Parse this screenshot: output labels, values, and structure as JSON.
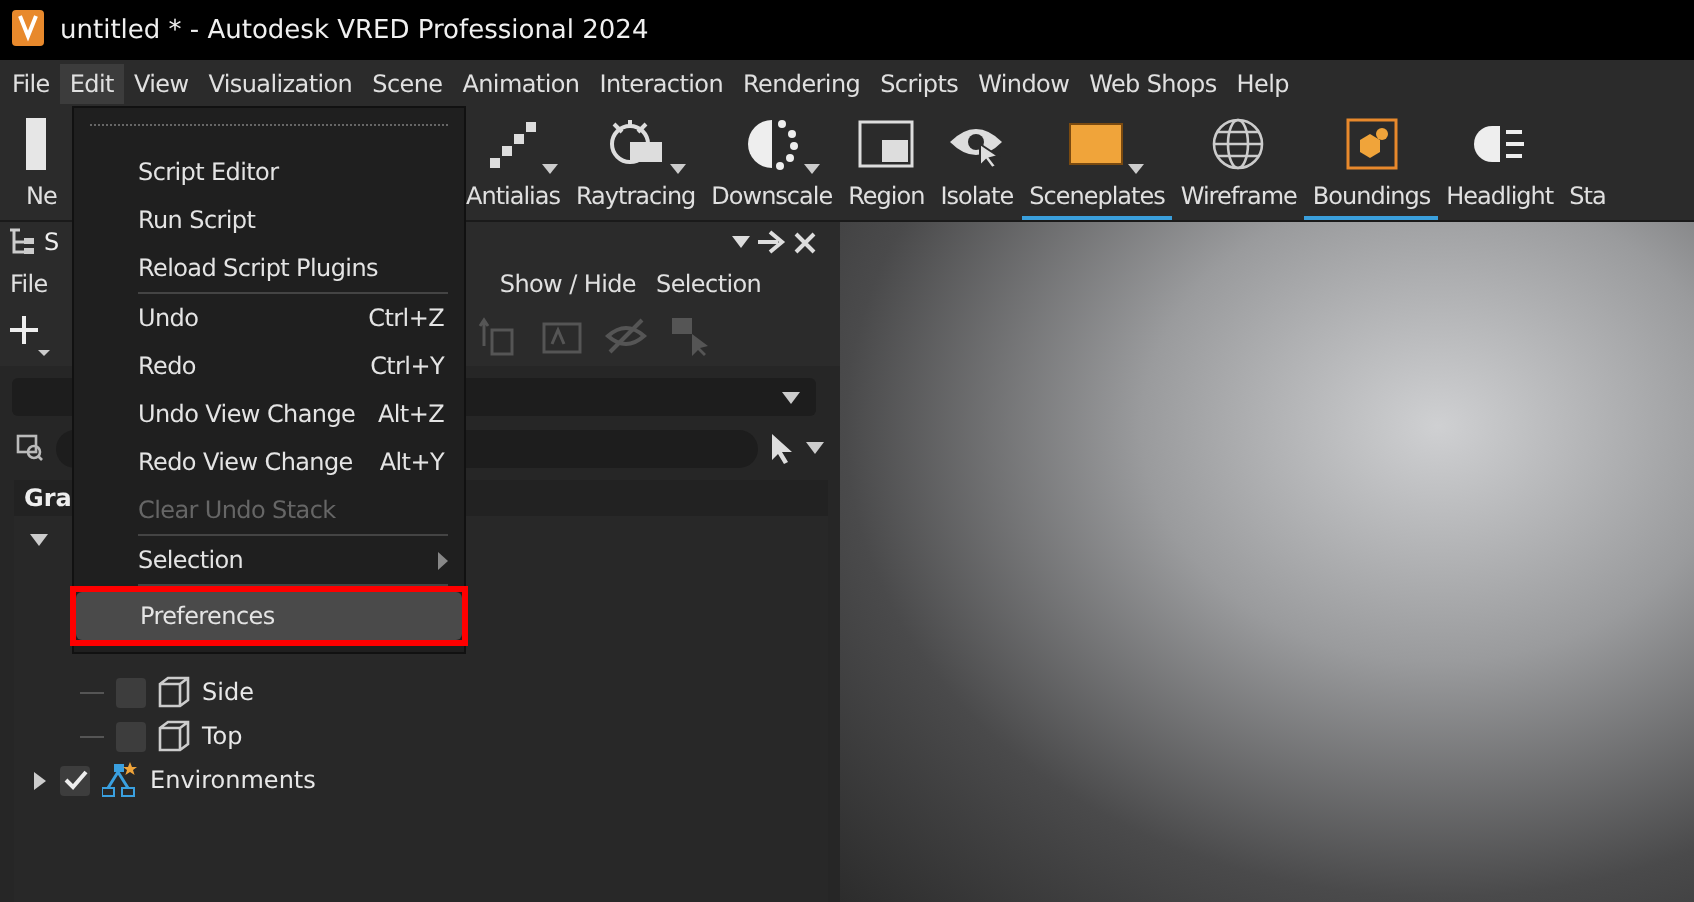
{
  "window": {
    "title": "untitled * - Autodesk VRED Professional 2024"
  },
  "menubar": [
    {
      "label": "File",
      "selected": false
    },
    {
      "label": "Edit",
      "selected": true
    },
    {
      "label": "View",
      "selected": false
    },
    {
      "label": "Visualization",
      "selected": false
    },
    {
      "label": "Scene",
      "selected": false
    },
    {
      "label": "Animation",
      "selected": false
    },
    {
      "label": "Interaction",
      "selected": false
    },
    {
      "label": "Rendering",
      "selected": false
    },
    {
      "label": "Scripts",
      "selected": false
    },
    {
      "label": "Window",
      "selected": false
    },
    {
      "label": "Web Shops",
      "selected": false
    },
    {
      "label": "Help",
      "selected": false
    }
  ],
  "toolbar": [
    {
      "label": "Ne",
      "kind": "page",
      "selected": false,
      "dropdown": false
    },
    {
      "label": "Antialias",
      "kind": "antialias",
      "selected": false,
      "dropdown": true
    },
    {
      "label": "Raytracing",
      "kind": "cpu",
      "selected": false,
      "dropdown": true
    },
    {
      "label": "Downscale",
      "kind": "downscale",
      "selected": false,
      "dropdown": true
    },
    {
      "label": "Region",
      "kind": "region",
      "selected": false,
      "dropdown": false
    },
    {
      "label": "Isolate",
      "kind": "isolate",
      "selected": false,
      "dropdown": false
    },
    {
      "label": "Sceneplates",
      "kind": "sceneplate",
      "selected": true,
      "dropdown": true
    },
    {
      "label": "Wireframe",
      "kind": "globe",
      "selected": false,
      "dropdown": false
    },
    {
      "label": "Boundings",
      "kind": "box",
      "selected": true,
      "dropdown": false
    },
    {
      "label": "Headlight",
      "kind": "headlight",
      "selected": false,
      "dropdown": false
    },
    {
      "label": "Sta",
      "kind": "none",
      "selected": false,
      "dropdown": false
    }
  ],
  "edit_menu": [
    {
      "kind": "tearoff"
    },
    {
      "kind": "item",
      "label": "Script Editor",
      "disabled": false,
      "selected": false,
      "annotated": false
    },
    {
      "kind": "item",
      "label": "Run Script",
      "disabled": false,
      "selected": false,
      "annotated": false
    },
    {
      "kind": "item",
      "label": "Reload Script Plugins",
      "disabled": false,
      "selected": false,
      "annotated": false
    },
    {
      "kind": "separator"
    },
    {
      "kind": "item",
      "label": "Undo",
      "shortcut": "Ctrl+Z",
      "disabled": false,
      "selected": false,
      "annotated": false
    },
    {
      "kind": "item",
      "label": "Redo",
      "shortcut": "Ctrl+Y",
      "disabled": false,
      "selected": false,
      "annotated": false
    },
    {
      "kind": "item",
      "label": "Undo View Change",
      "shortcut": "Alt+Z",
      "disabled": false,
      "selected": false,
      "annotated": false
    },
    {
      "kind": "item",
      "label": "Redo View Change",
      "shortcut": "Alt+Y",
      "disabled": false,
      "selected": false,
      "annotated": false
    },
    {
      "kind": "item",
      "label": "Clear Undo Stack",
      "disabled": true,
      "selected": false,
      "annotated": false
    },
    {
      "kind": "separator"
    },
    {
      "kind": "submenu",
      "label": "Selection",
      "disabled": false,
      "selected": false,
      "annotated": false
    },
    {
      "kind": "separator"
    },
    {
      "kind": "item",
      "label": "Preferences",
      "disabled": false,
      "selected": true,
      "annotated": true
    }
  ],
  "scenegraph": {
    "title": "S",
    "menu": [
      "File",
      "Show / Hide",
      "Selection"
    ],
    "column_header": "Gra",
    "tree": [
      {
        "expanded": true,
        "children": [
          {
            "label": "Side",
            "checked": false,
            "kind": "camera"
          },
          {
            "label": "Top",
            "checked": false,
            "kind": "camera"
          }
        ]
      },
      {
        "label": "Environments",
        "expanded": false,
        "checked": true,
        "kind": "environment"
      }
    ]
  }
}
